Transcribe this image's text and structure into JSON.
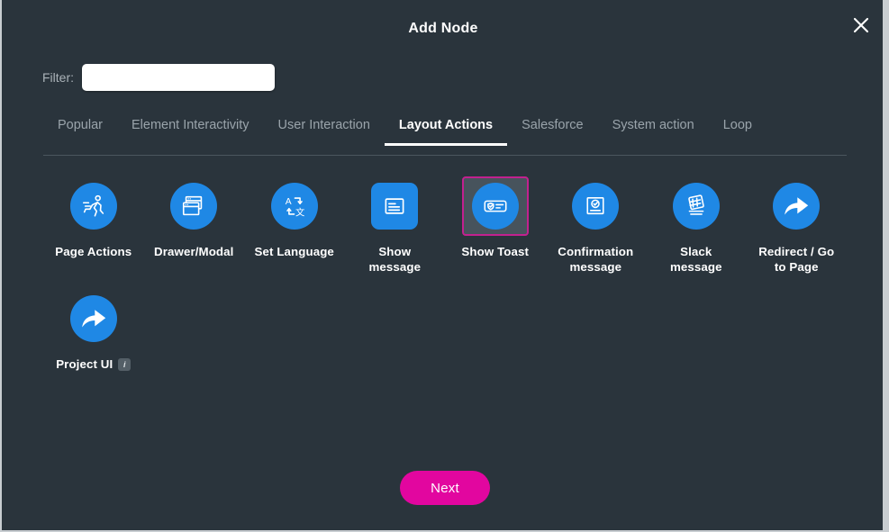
{
  "dialog": {
    "title": "Add Node",
    "close_icon": "close-icon"
  },
  "filter": {
    "label": "Filter:",
    "value": "",
    "placeholder": ""
  },
  "tabs": [
    {
      "label": "Popular",
      "active": false
    },
    {
      "label": "Element Interactivity",
      "active": false
    },
    {
      "label": "User Interaction",
      "active": false
    },
    {
      "label": "Layout Actions",
      "active": true
    },
    {
      "label": "Salesforce",
      "active": false
    },
    {
      "label": "System action",
      "active": false
    },
    {
      "label": "Loop",
      "active": false
    }
  ],
  "nodes": [
    {
      "label": "Page Actions",
      "icon": "running-person-icon",
      "shape": "circle",
      "selected": false,
      "badge": null
    },
    {
      "label": "Drawer/Modal",
      "icon": "windows-stack-icon",
      "shape": "circle",
      "selected": false,
      "badge": null
    },
    {
      "label": "Set Language",
      "icon": "translate-icon",
      "shape": "circle",
      "selected": false,
      "badge": null
    },
    {
      "label": "Show\nmessage",
      "icon": "message-lines-icon",
      "shape": "rounded-square",
      "selected": false,
      "badge": null
    },
    {
      "label": "Show Toast",
      "icon": "toast-badge-icon",
      "shape": "circle",
      "selected": true,
      "badge": null
    },
    {
      "label": "Confirmation\nmessage",
      "icon": "confirmation-check-icon",
      "shape": "circle",
      "selected": false,
      "badge": null
    },
    {
      "label": "Slack\nmessage",
      "icon": "slack-hash-icon",
      "shape": "circle",
      "selected": false,
      "badge": null
    },
    {
      "label": "Redirect / Go\nto Page",
      "icon": "share-arrow-icon",
      "shape": "circle",
      "selected": false,
      "badge": null
    },
    {
      "label": "Project UI",
      "icon": "share-arrow-icon",
      "shape": "circle",
      "selected": false,
      "badge": "i"
    }
  ],
  "footer": {
    "next_label": "Next"
  },
  "colors": {
    "background": "#2a343c",
    "icon_blue": "#1f88e5",
    "accent_magenta": "#e2069f",
    "selection_border": "#c2218f",
    "text_primary": "#ffffff",
    "text_muted": "#9aa4ab"
  }
}
